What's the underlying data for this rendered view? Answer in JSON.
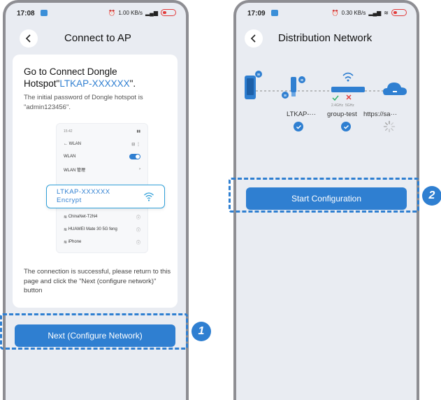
{
  "phone1": {
    "status_time": "17:08",
    "status_speed": "1.00 KB/s",
    "nav_title": "Connect to AP",
    "heading_prefix": "Go to Connect Dongle Hotspot\"",
    "heading_ssid": "LTKAP-XXXXXX",
    "heading_suffix": "\".",
    "password_text": "The initial password of Dongle hotspot is \"admin123456\".",
    "mini_screen": {
      "time": "15:42",
      "back_label": "←  WLAN",
      "wlan_label": "WLAN",
      "wlan_settings_label": "WLAN 管理",
      "networks": [
        "ChinaNet-T2N4",
        "HUAWEI Mate 30 5G feng",
        "iPhone"
      ]
    },
    "highlight_ssid": "LTKAP-XXXXXX",
    "highlight_security": "Encrypt",
    "note_text": "The connection is successful, please return to this page and click the \"Next (configure network)\" button",
    "next_button_label": "Next (Configure Network)",
    "step_number": "1"
  },
  "phone2": {
    "status_time": "17:09",
    "status_speed": "0.30 KB/s",
    "nav_title": "Distribution Network",
    "band_24": "2.4GHz",
    "band_5": "5GHz",
    "device_labels": [
      "LTKAP-···",
      "group-test",
      "https://sa···"
    ],
    "start_button_label": "Start Configuration",
    "step_number": "2"
  },
  "colors": {
    "accent": "#2f7fd1",
    "background": "#e9ecf2",
    "success": "#2fb36b",
    "error": "#e23b3b"
  }
}
